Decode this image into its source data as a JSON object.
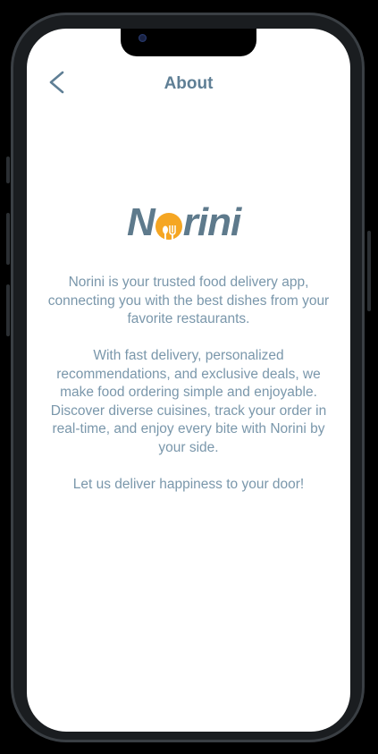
{
  "header": {
    "title": "About",
    "back_icon": "chevron-left-icon"
  },
  "logo": {
    "text": "Norini",
    "icon": "fork-spoon-icon",
    "brand_color": "#5e7a8c",
    "accent_color": "#f5a623"
  },
  "about": {
    "paragraph1": "Norini is your trusted food delivery app, connecting you with the best dishes from your favorite restaurants.",
    "paragraph2": "With fast delivery, personalized recommendations, and exclusive deals, we make food ordering simple and enjoyable. Discover diverse cuisines, track your order in real-time, and enjoy every bite with Norini by your side.",
    "paragraph3": "Let us deliver happiness to your door!"
  }
}
